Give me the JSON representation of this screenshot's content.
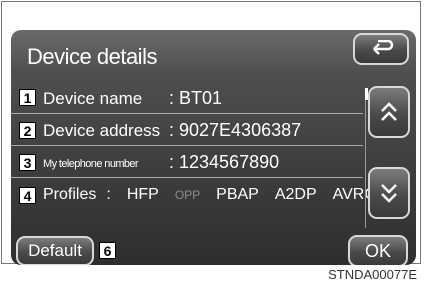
{
  "screen": {
    "title": "Device details",
    "rows": [
      {
        "num": "1",
        "label": "Device name",
        "value": ": BT01"
      },
      {
        "num": "2",
        "label": "Device address",
        "value": ": 9027E4306387"
      },
      {
        "num": "3",
        "label": "My telephone number",
        "value": ": 1234567890"
      }
    ],
    "profiles": {
      "num": "4",
      "label": "Profiles",
      "sep": ":",
      "items": [
        "HFP",
        "OPP",
        "PBAP",
        "A2DP",
        "AVRCP"
      ],
      "disabled": [
        "OPP"
      ]
    },
    "default_label": "Default",
    "default_num": "6",
    "ok_label": "OK",
    "back_icon": "back-arrow-icon",
    "up_icon": "double-chevron-up-icon",
    "down_icon": "double-chevron-down-icon"
  },
  "footer_code": "STNDA00077E"
}
